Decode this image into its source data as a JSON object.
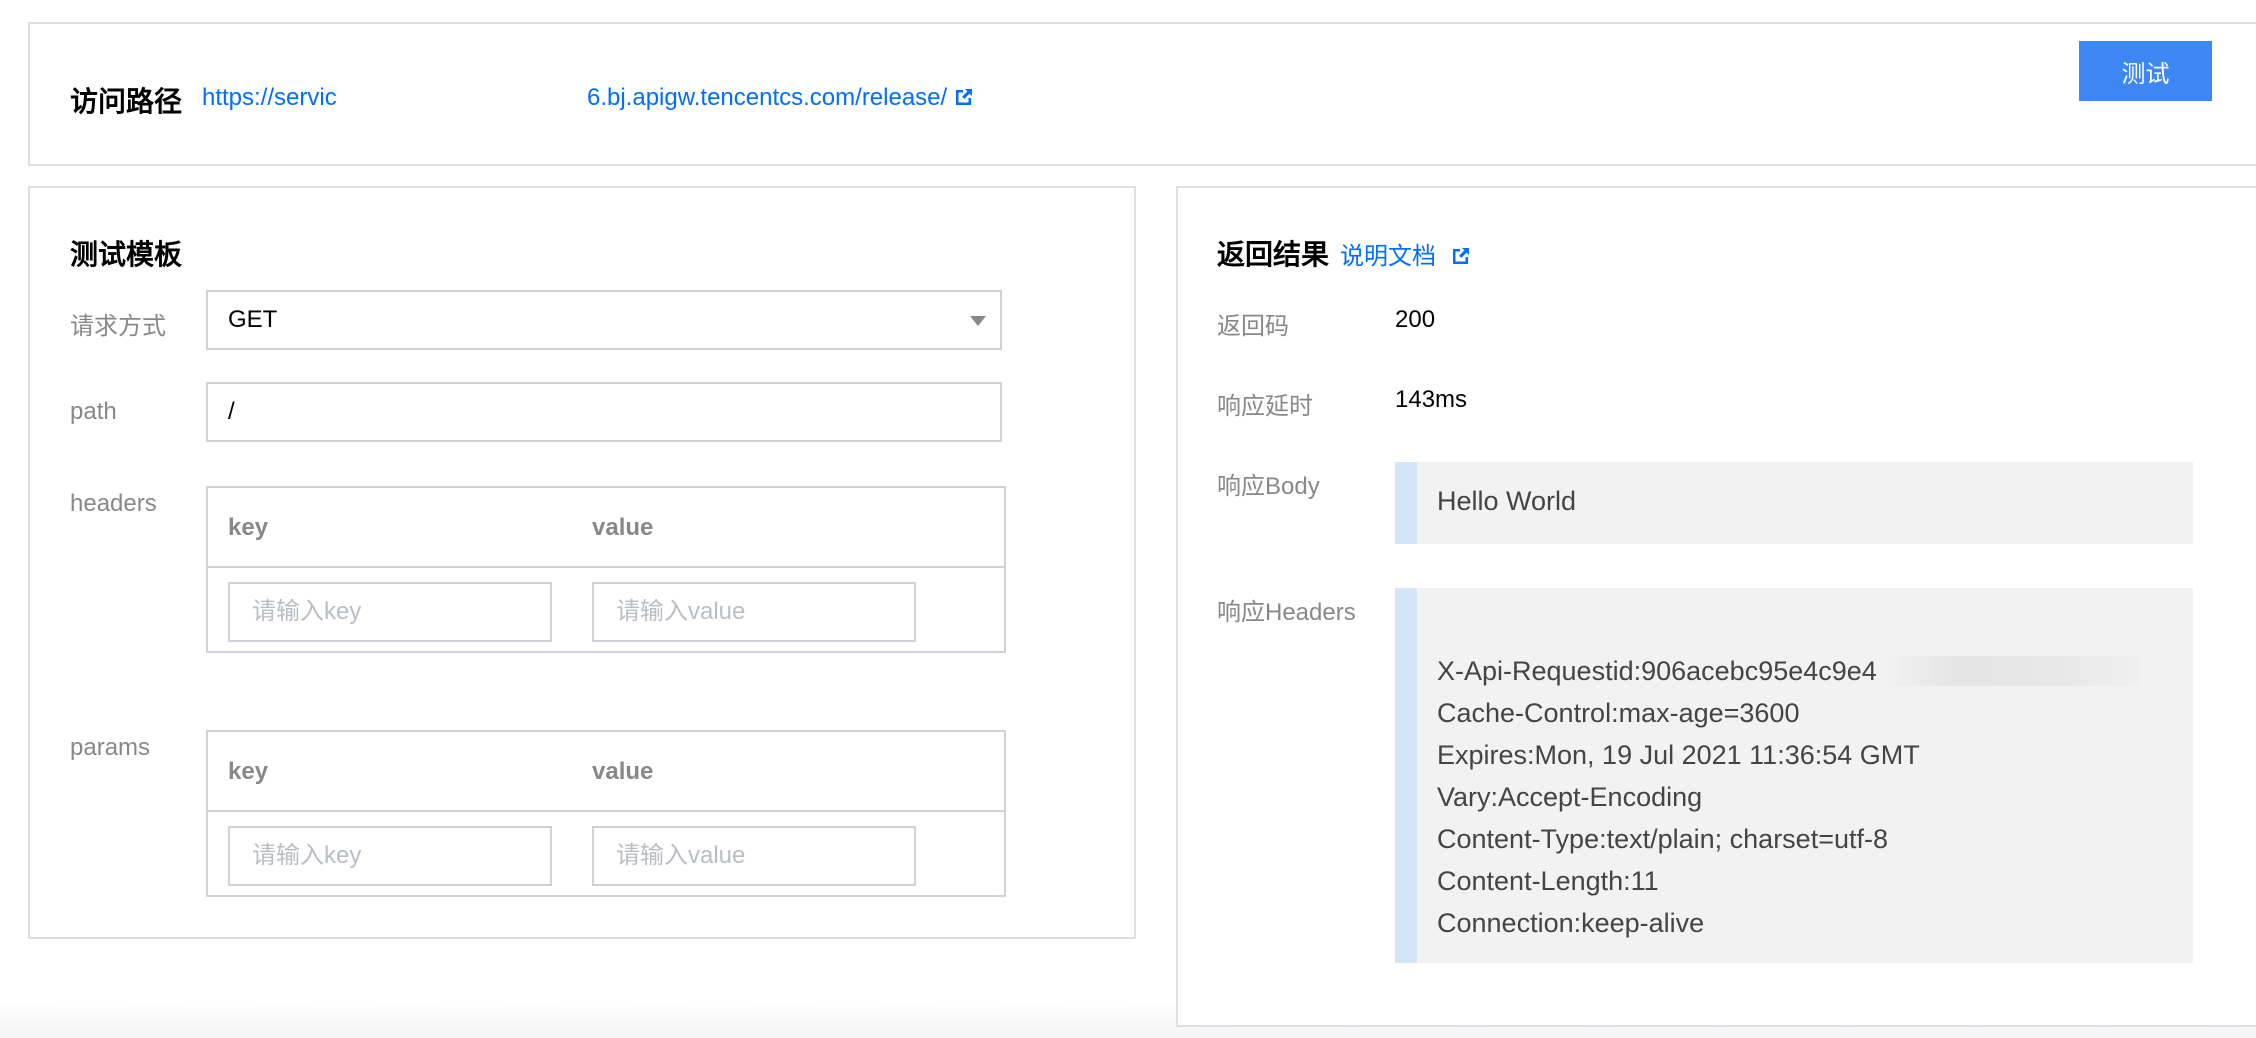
{
  "access_path": {
    "title": "访问路径",
    "url_start": "https://servic",
    "url_end": "6.bj.apigw.tencentcs.com/release/",
    "test_label": "测试"
  },
  "template": {
    "title": "测试模板",
    "method_label": "请求方式",
    "method_value": "GET",
    "path_label": "path",
    "path_value": "/",
    "headers_label": "headers",
    "params_label": "params",
    "key_header": "key",
    "value_header": "value",
    "key_placeholder": "请输入key",
    "value_placeholder": "请输入value"
  },
  "result": {
    "title": "返回结果",
    "doc_link": "说明文档",
    "code_label": "返回码",
    "code_value": "200",
    "latency_label": "响应延时",
    "latency_value": "143ms",
    "body_label": "响应Body",
    "body_value": "Hello World",
    "headers_label": "响应Headers",
    "headers_lines": [
      "X-Api-Requestid:906acebc95e4c9e4",
      "Cache-Control:max-age=3600",
      "Expires:Mon, 19 Jul 2021 11:36:54 GMT",
      "Vary:Accept-Encoding",
      "Content-Type:text/plain; charset=utf-8",
      "Content-Length:11",
      "Connection:keep-alive"
    ]
  },
  "colors": {
    "accent": "#006eff",
    "button": "#3d87f5"
  }
}
